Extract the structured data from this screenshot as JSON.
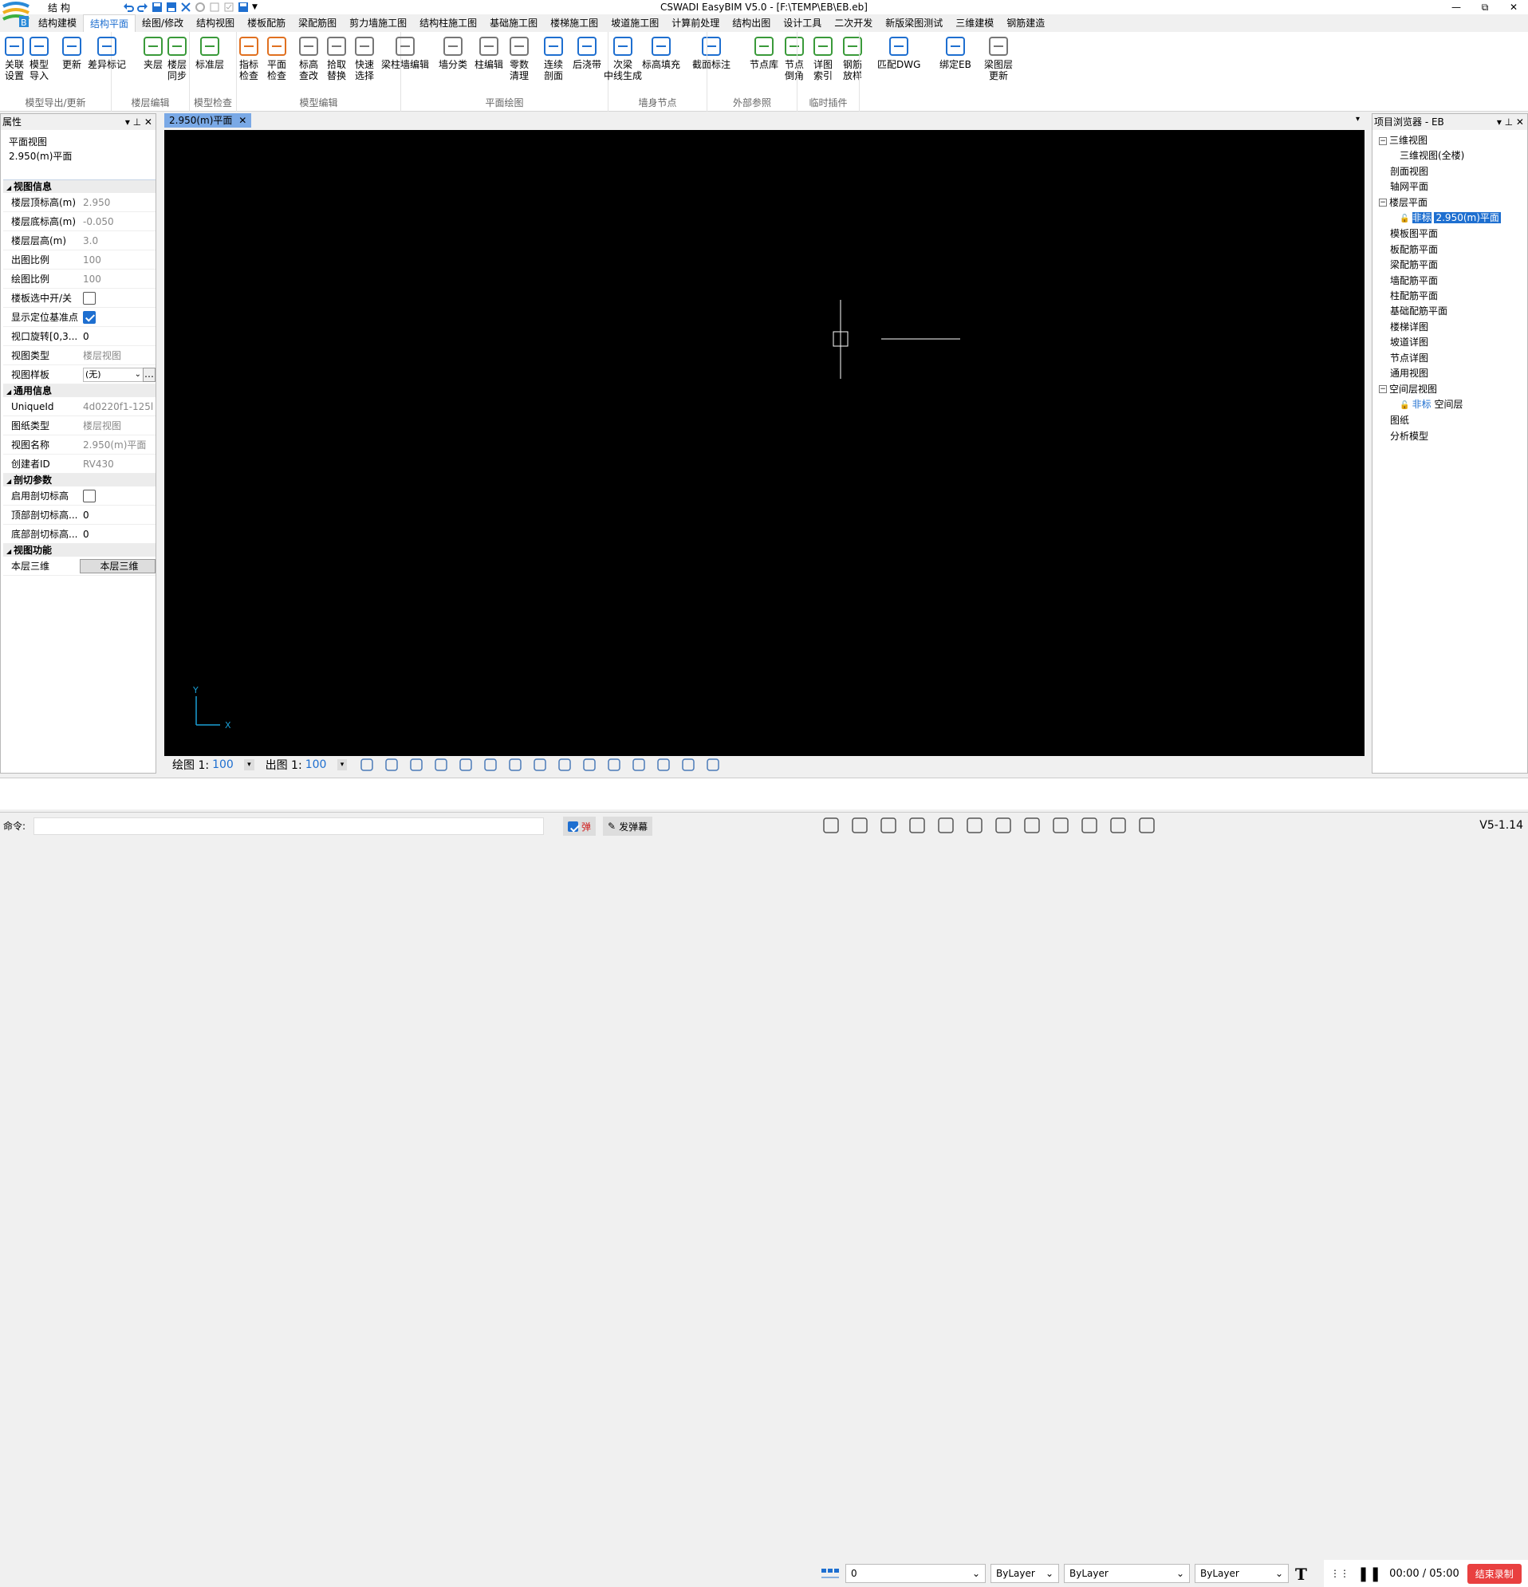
{
  "window": {
    "title": "CSWADI EasyBIM V5.0 - [F:\\TEMP\\EB\\EB.eb]",
    "workspace": "结 构",
    "controls": [
      "—",
      "⧉",
      "✕"
    ]
  },
  "tabs": [
    "结构建模",
    "结构平面",
    "绘图/修改",
    "结构视图",
    "楼板配筋",
    "梁配筋图",
    "剪力墙施工图",
    "结构柱施工图",
    "基础施工图",
    "楼梯施工图",
    "坡道施工图",
    "计算前处理",
    "结构出图",
    "设计工具",
    "二次开发",
    "新版梁图测试",
    "三维建模",
    "钢筋建造"
  ],
  "active_tab": "结构平面",
  "ribbon": {
    "groups": [
      {
        "label": "模型导出/更新",
        "buttons": [
          [
            "关联",
            "设置"
          ],
          [
            "模型",
            "导入"
          ],
          [
            "更新",
            ""
          ],
          [
            "差异标记",
            ""
          ]
        ]
      },
      {
        "label": "楼层编辑",
        "buttons": [
          [
            "夹层",
            ""
          ],
          [
            "楼层",
            "同步"
          ],
          [
            "标准层",
            ""
          ]
        ]
      },
      {
        "label": "模型检查",
        "buttons": [
          [
            "指标",
            "检查"
          ],
          [
            "平面",
            "检查"
          ]
        ]
      },
      {
        "label": "模型编辑",
        "buttons": [
          [
            "标高",
            "查改"
          ],
          [
            "拾取",
            "替换"
          ],
          [
            "快速",
            "选择"
          ],
          [
            "梁柱墙编辑",
            ""
          ],
          [
            "墙分类",
            ""
          ],
          [
            "柱编辑",
            ""
          ],
          [
            "零数",
            "清理"
          ]
        ]
      },
      {
        "label": "平面绘图",
        "buttons": [
          [
            "连续",
            "剖面"
          ],
          [
            "后浇带",
            ""
          ],
          [
            "次梁",
            "中线生成"
          ],
          [
            "标高填充",
            ""
          ],
          [
            "截面标注",
            ""
          ]
        ]
      },
      {
        "label": "墙身节点",
        "buttons": [
          [
            "节点库",
            ""
          ],
          [
            "节点",
            "倒角"
          ],
          [
            "详图",
            "索引"
          ],
          [
            "钢筋",
            "放样"
          ]
        ]
      },
      {
        "label": "外部参照",
        "buttons": [
          [
            "匹配DWG",
            ""
          ],
          [
            "绑定EB",
            ""
          ]
        ]
      },
      {
        "label": "临时插件",
        "buttons": [
          [
            "梁图层",
            "更新"
          ]
        ]
      }
    ]
  },
  "props": {
    "title": "属性",
    "pin": "▾ ⊥ ✕",
    "view_kind": "平面视图",
    "view_name": "2.950(m)平面",
    "sections": [
      {
        "title": "视图信息",
        "rows": [
          {
            "k": "楼层顶标高(m)",
            "v": "2.950"
          },
          {
            "k": "楼层底标高(m)",
            "v": "-0.050"
          },
          {
            "k": "楼层层高(m)",
            "v": "3.0"
          },
          {
            "k": "出图比例",
            "v": "100"
          },
          {
            "k": "绘图比例",
            "v": "100"
          },
          {
            "k": "楼板选中开/关",
            "v": ""
          },
          {
            "k": "显示定位基准点",
            "v": ""
          },
          {
            "k": "视口旋转[0,3...",
            "v": "0"
          },
          {
            "k": "视图类型",
            "v": "楼层视图"
          },
          {
            "k": "视图样板",
            "v": "(无)"
          }
        ]
      },
      {
        "title": "通用信息",
        "rows": [
          {
            "k": "UniqueId",
            "v": "4d0220f1-125l"
          },
          {
            "k": "图纸类型",
            "v": "楼层视图"
          },
          {
            "k": "视图名称",
            "v": "2.950(m)平面"
          },
          {
            "k": "创建者ID",
            "v": "RV430"
          }
        ]
      },
      {
        "title": "剖切参数",
        "rows": [
          {
            "k": "启用剖切标高",
            "v": ""
          },
          {
            "k": "顶部剖切标高...",
            "v": "0"
          },
          {
            "k": "底部剖切标高...",
            "v": "0"
          }
        ]
      },
      {
        "title": "视图功能",
        "rows": [
          {
            "k": "本层三维",
            "v": "本层三维"
          }
        ]
      }
    ]
  },
  "doc_tab": "2.950(m)平面",
  "viewbar": {
    "draw_label": "绘图 1:",
    "draw_val": "100",
    "out_label": "出图 1:",
    "out_val": "100"
  },
  "axis": {
    "x": "X",
    "y": "Y"
  },
  "browser": {
    "title": "项目浏览器 - EB",
    "pin": "▾ ⊥ ✕",
    "tree": [
      {
        "t": "三维视图",
        "lvl": "l0b",
        "tog": "−"
      },
      {
        "t": "三维视图(全楼)",
        "lvl": "l1"
      },
      {
        "t": "剖面视图",
        "lvl": "l0"
      },
      {
        "t": "轴网平面",
        "lvl": "l0"
      },
      {
        "t": "楼层平面",
        "lvl": "l0b",
        "tog": "−"
      },
      {
        "t": "2.950(m)平面",
        "lvl": "l1",
        "sel": true,
        "pre": "非标"
      },
      {
        "t": "模板图平面",
        "lvl": "l0"
      },
      {
        "t": "板配筋平面",
        "lvl": "l0"
      },
      {
        "t": "梁配筋平面",
        "lvl": "l0"
      },
      {
        "t": "墙配筋平面",
        "lvl": "l0"
      },
      {
        "t": "柱配筋平面",
        "lvl": "l0"
      },
      {
        "t": "基础配筋平面",
        "lvl": "l0"
      },
      {
        "t": "楼梯详图",
        "lvl": "l0"
      },
      {
        "t": "坡道详图",
        "lvl": "l0"
      },
      {
        "t": "节点详图",
        "lvl": "l0"
      },
      {
        "t": "通用视图",
        "lvl": "l0"
      },
      {
        "t": "空间层视图",
        "lvl": "l0b",
        "tog": "−"
      },
      {
        "t": "空间层",
        "lvl": "l1",
        "pre": "非标"
      },
      {
        "t": "图纸",
        "lvl": "l0"
      },
      {
        "t": "分析模型",
        "lvl": "l0"
      }
    ]
  },
  "layerbar": {
    "layer": "0",
    "color": "ByLayer",
    "linetype": "ByLayer",
    "lineweight": "ByLayer"
  },
  "recorder": {
    "time": "00:00 / 05:00",
    "stop": "结束录制"
  },
  "status": {
    "cmd_label": "命令:",
    "btn1": "弹",
    "btn2": "发弹幕",
    "version": "V5-1.14"
  }
}
